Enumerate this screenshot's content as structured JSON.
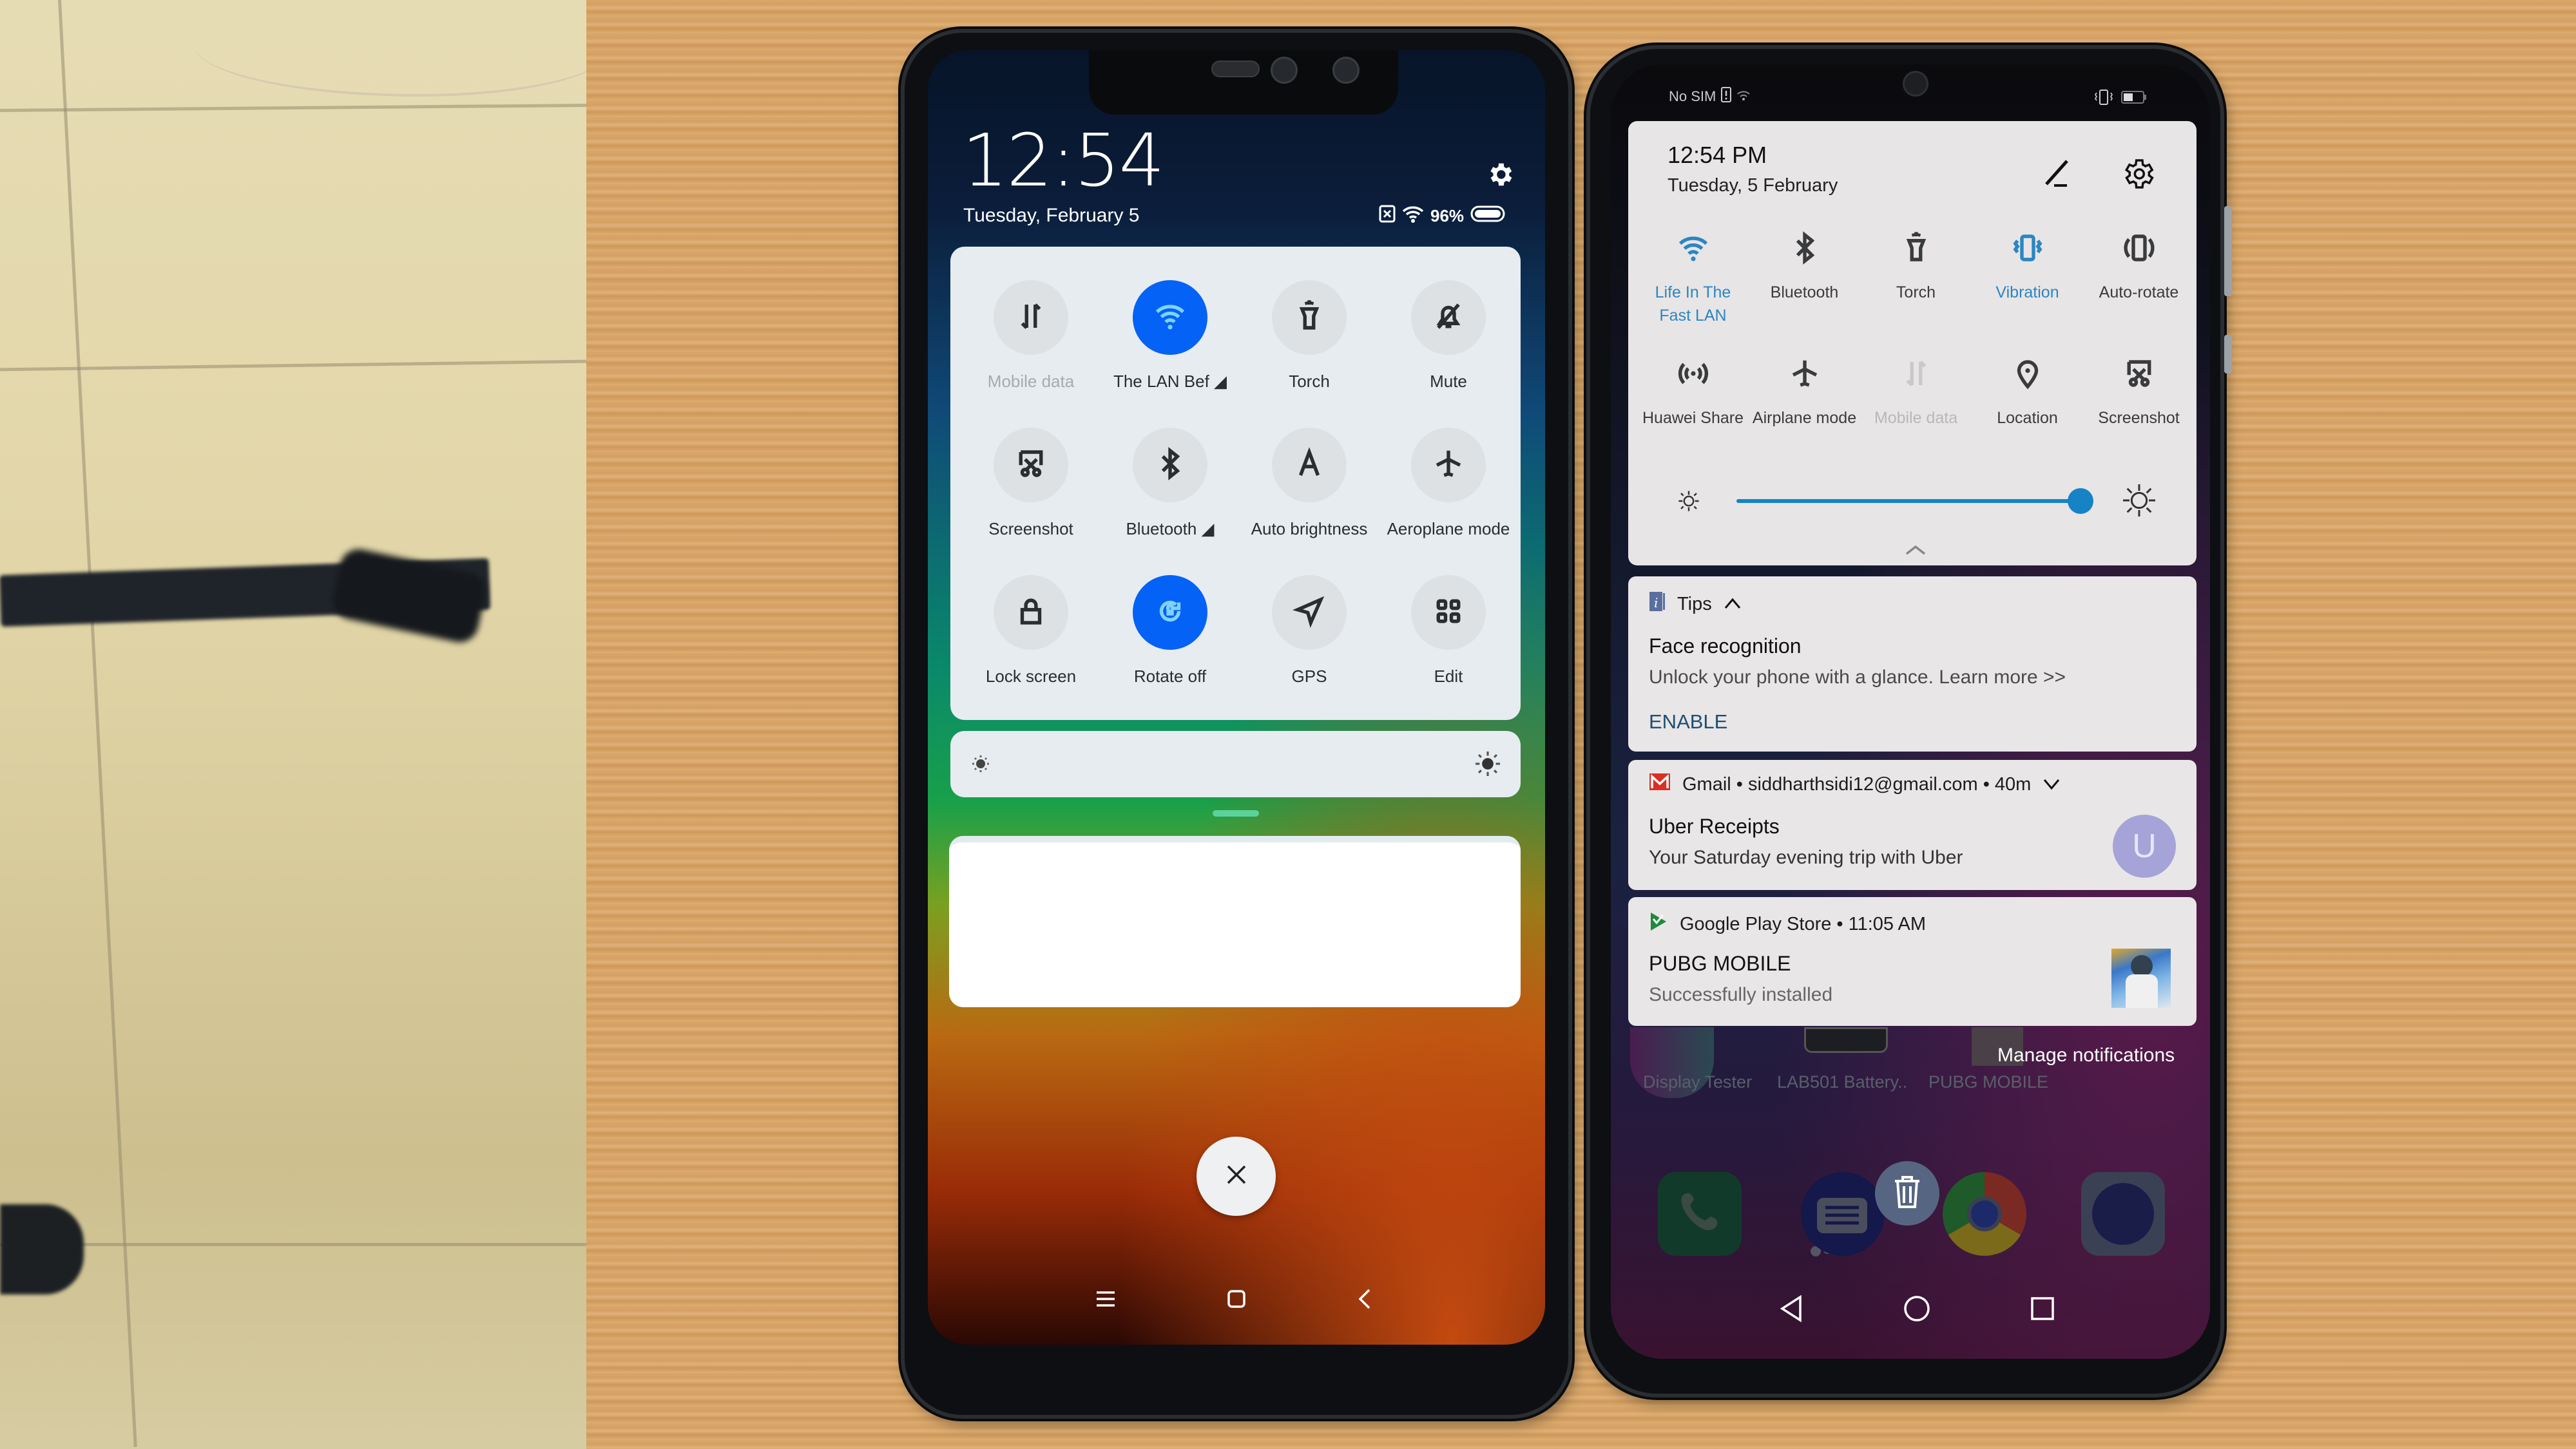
{
  "left_phone": {
    "status": {
      "time": "12:54",
      "date": "Tuesday, February 5",
      "battery_percent": "96%",
      "icons": [
        "no-sim-icon",
        "wifi-icon",
        "battery-icon"
      ]
    },
    "quick_settings": [
      {
        "label": "Mobile data",
        "icon": "mobile-data-icon",
        "active": false,
        "disabled": true
      },
      {
        "label": "The LAN Bef",
        "icon": "wifi-icon",
        "active": true,
        "has_expand": true
      },
      {
        "label": "Torch",
        "icon": "torch-icon",
        "active": false
      },
      {
        "label": "Mute",
        "icon": "mute-bell-icon",
        "active": false
      },
      {
        "label": "Screenshot",
        "icon": "screenshot-icon",
        "active": false
      },
      {
        "label": "Bluetooth",
        "icon": "bluetooth-icon",
        "active": false,
        "has_expand": true
      },
      {
        "label": "Auto brightness",
        "icon": "auto-brightness-icon",
        "active": false
      },
      {
        "label": "Aeroplane mode",
        "icon": "airplane-icon",
        "active": false
      },
      {
        "label": "Lock screen",
        "icon": "lock-icon",
        "active": false
      },
      {
        "label": "Rotate off",
        "icon": "rotation-lock-icon",
        "active": true
      },
      {
        "label": "GPS",
        "icon": "gps-icon",
        "active": false
      },
      {
        "label": "Edit",
        "icon": "grid-edit-icon",
        "active": false
      }
    ],
    "brightness": {
      "min_icon": "brightness-low-icon",
      "max_icon": "brightness-high-icon"
    },
    "clear_button": "close-icon",
    "nav": [
      "menu-icon",
      "home-icon",
      "back-icon"
    ],
    "colors": {
      "accent": "#0462f6",
      "tile_bg": "#dde1e4",
      "panel_bg": "#e7ecf0"
    }
  },
  "right_phone": {
    "status": {
      "carrier": "No SIM",
      "icons": [
        "sim-alert-icon",
        "wifi-icon",
        "vibrate-icon",
        "battery-icon"
      ]
    },
    "header": {
      "time": "12:54 PM",
      "date": "Tuesday, 5 February"
    },
    "quick_settings": [
      {
        "label": "Life In The Fast LAN",
        "icon": "wifi-icon",
        "state": "active"
      },
      {
        "label": "Bluetooth",
        "icon": "bluetooth-icon",
        "state": "off"
      },
      {
        "label": "Torch",
        "icon": "torch-icon",
        "state": "off"
      },
      {
        "label": "Vibration",
        "icon": "vibrate-icon",
        "state": "active"
      },
      {
        "label": "Auto-rotate",
        "icon": "auto-rotate-icon",
        "state": "off"
      },
      {
        "label": "Huawei Share",
        "icon": "huawei-share-icon",
        "state": "off"
      },
      {
        "label": "Airplane mode",
        "icon": "airplane-icon",
        "state": "off"
      },
      {
        "label": "Mobile data",
        "icon": "mobile-data-icon",
        "state": "disabled"
      },
      {
        "label": "Location",
        "icon": "location-icon",
        "state": "off"
      },
      {
        "label": "Screenshot",
        "icon": "screenshot-icon",
        "state": "off"
      }
    ],
    "brightness_level": 0.97,
    "notifications": [
      {
        "app": "Tips",
        "icon": "tips-icon",
        "header": "Tips",
        "title": "Face recognition",
        "body": "Unlock your phone with a glance. Learn more >>",
        "action": "ENABLE"
      },
      {
        "app": "Gmail",
        "icon": "gmail-icon",
        "header": "Gmail • siddharthsidi12@gmail.com • 40m",
        "title": "Uber Receipts",
        "body": "Your Saturday evening trip with Uber",
        "avatar_letter": "U"
      },
      {
        "app": "Google Play Store",
        "icon": "play-store-icon",
        "header": "Google Play Store • 11:05 AM",
        "title": "PUBG MOBILE",
        "body": "Successfully installed"
      }
    ],
    "manage_notifications": "Manage notifications",
    "home_apps": [
      "Display Tester",
      "LAB501 Battery..",
      "PUBG MOBILE"
    ],
    "dock": [
      "phone-icon",
      "messages-icon",
      "trash-icon",
      "chrome-icon",
      "camera-icon"
    ],
    "nav": [
      "back-icon",
      "home-icon",
      "recents-icon"
    ],
    "colors": {
      "accent": "#1583c6",
      "active_label": "#2b86c2",
      "panel_bg": "#e8e5e6",
      "gmail_red": "#d93025",
      "enable_blue": "#1d4f73"
    }
  }
}
